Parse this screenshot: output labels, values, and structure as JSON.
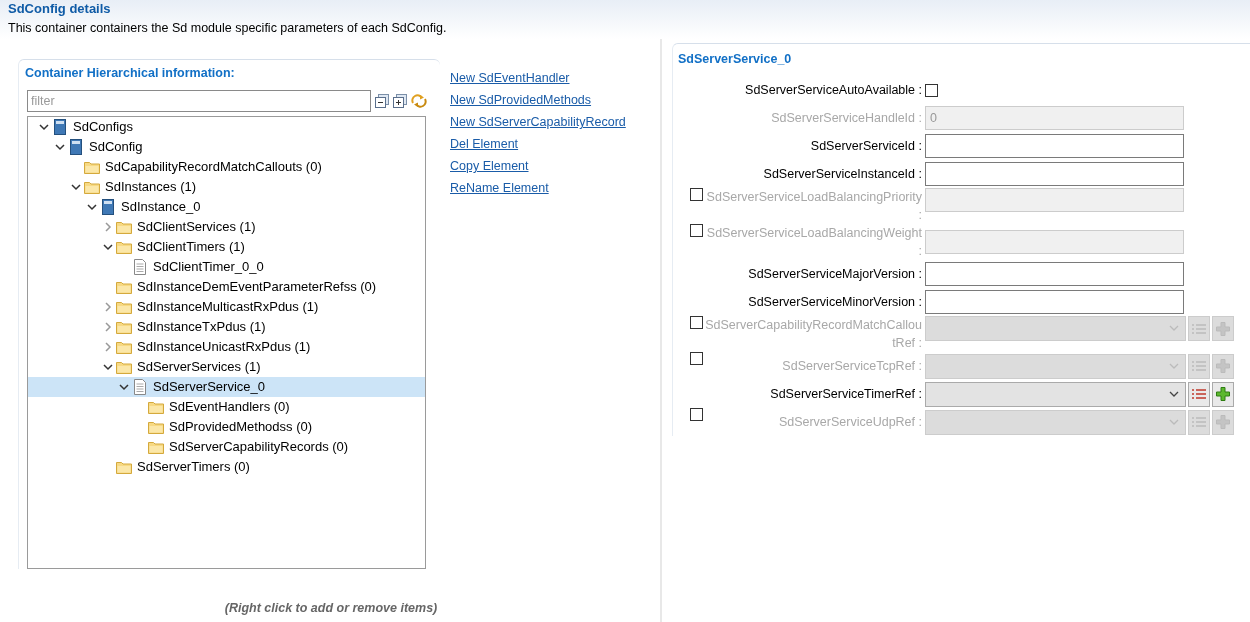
{
  "header": {
    "title": "SdConfig details",
    "description": "This container containers the Sd module specific parameters of each SdConfig."
  },
  "hierarchy": {
    "title": "Container Hierarchical information:",
    "filter": {
      "placeholder": "filter"
    },
    "tree": [
      {
        "label": "SdConfigs",
        "kind": "book",
        "expanded": true,
        "selected": false,
        "children": [
          {
            "label": "SdConfig",
            "kind": "book",
            "expanded": true,
            "selected": false,
            "children": [
              {
                "label": "SdCapabilityRecordMatchCallouts (0)",
                "kind": "folder",
                "selected": false
              },
              {
                "label": "SdInstances (1)",
                "kind": "folder",
                "expanded": true,
                "selected": false,
                "children": [
                  {
                    "label": "SdInstance_0",
                    "kind": "book",
                    "expanded": true,
                    "selected": false,
                    "children": [
                      {
                        "label": "SdClientServices (1)",
                        "kind": "folder",
                        "expanded": false,
                        "selected": false
                      },
                      {
                        "label": "SdClientTimers (1)",
                        "kind": "folder",
                        "expanded": true,
                        "selected": false,
                        "children": [
                          {
                            "label": "SdClientTimer_0_0",
                            "kind": "file",
                            "selected": false
                          }
                        ]
                      },
                      {
                        "label": "SdInstanceDemEventParameterRefss (0)",
                        "kind": "folder",
                        "selected": false
                      },
                      {
                        "label": "SdInstanceMulticastRxPdus (1)",
                        "kind": "folder",
                        "expanded": false,
                        "selected": false
                      },
                      {
                        "label": "SdInstanceTxPdus (1)",
                        "kind": "folder",
                        "expanded": false,
                        "selected": false
                      },
                      {
                        "label": "SdInstanceUnicastRxPdus (1)",
                        "kind": "folder",
                        "expanded": false,
                        "selected": false
                      },
                      {
                        "label": "SdServerServices (1)",
                        "kind": "folder",
                        "expanded": true,
                        "selected": false,
                        "children": [
                          {
                            "label": "SdServerService_0",
                            "kind": "file",
                            "expanded": true,
                            "selected": true,
                            "children": [
                              {
                                "label": "SdEventHandlers (0)",
                                "kind": "folder",
                                "selected": false
                              },
                              {
                                "label": "SdProvidedMethodss (0)",
                                "kind": "folder",
                                "selected": false
                              },
                              {
                                "label": "SdServerCapabilityRecords (0)",
                                "kind": "folder",
                                "selected": false
                              }
                            ]
                          }
                        ]
                      },
                      {
                        "label": "SdServerTimers (0)",
                        "kind": "folder",
                        "selected": false
                      }
                    ]
                  }
                ]
              }
            ]
          }
        ]
      }
    ]
  },
  "actions": [
    "New SdEventHandler",
    "New SdProvidedMethods",
    "New SdServerCapabilityRecord",
    "Del Element",
    "Copy Element",
    "ReName Element"
  ],
  "hint": "(Right click to add or remove items)",
  "detail": {
    "title": "SdServerService_0",
    "fields": [
      {
        "kind": "checkbox",
        "label": "SdServerServiceAutoAvailable :",
        "enabled": true,
        "checked": false
      },
      {
        "kind": "text",
        "label": "SdServerServiceHandleId :",
        "enabled": false,
        "value": "0"
      },
      {
        "kind": "text",
        "label": "SdServerServiceId :",
        "enabled": true
      },
      {
        "kind": "text",
        "label": "SdServerServiceInstanceId :",
        "enabled": true
      },
      {
        "kind": "text",
        "label": "SdServerServiceLoadBalancingPriority :",
        "enabled": false,
        "toggle_checked": false
      },
      {
        "kind": "text",
        "label": "SdServerServiceLoadBalancingWeight :",
        "enabled": false,
        "toggle_checked": false
      },
      {
        "kind": "text",
        "label": "SdServerServiceMajorVersion :",
        "enabled": true
      },
      {
        "kind": "text",
        "label": "SdServerServiceMinorVersion :",
        "enabled": true
      },
      {
        "kind": "reference",
        "label": "SdServerCapabilityRecordMatchCalloutRef :",
        "enabled": false,
        "toggle_checked": false
      },
      {
        "kind": "reference",
        "label": "SdServerServiceTcpRef :",
        "enabled": false,
        "toggle_checked": false
      },
      {
        "kind": "reference",
        "label": "SdServerServiceTimerRef :",
        "enabled": true
      },
      {
        "kind": "reference",
        "label": "SdServerServiceUdpRef :",
        "enabled": false,
        "toggle_checked": false
      }
    ]
  }
}
